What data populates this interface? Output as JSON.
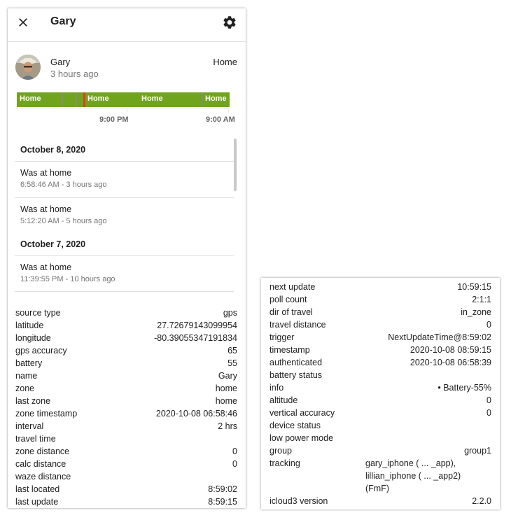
{
  "dialog": {
    "title": "Gary"
  },
  "entity": {
    "name": "Gary",
    "last_changed": "3 hours ago",
    "state": "Home"
  },
  "timeline": {
    "segments": [
      "Home",
      "Home",
      "Home",
      "Home"
    ],
    "ticks": [
      "9:00 PM",
      "9:00 AM"
    ],
    "colors": {
      "home": "#71a41d",
      "marker": "#e53935",
      "gap": "#8a8a7a"
    }
  },
  "logbook": {
    "days": [
      {
        "date": "October 8, 2020",
        "entries": [
          {
            "message": "Was at home",
            "when": "6:58:46 AM - 3 hours ago"
          },
          {
            "message": "Was at home",
            "when": "5:12:20 AM - 5 hours ago"
          }
        ]
      },
      {
        "date": "October 7, 2020",
        "entries": [
          {
            "message": "Was at home",
            "when": "11:39:55 PM - 10 hours ago"
          }
        ]
      }
    ]
  },
  "attributes_left": [
    {
      "key": "source type",
      "value": "gps"
    },
    {
      "key": "latitude",
      "value": "27.72679143099954"
    },
    {
      "key": "longitude",
      "value": "-80.39055347191834"
    },
    {
      "key": "gps accuracy",
      "value": "65"
    },
    {
      "key": "battery",
      "value": "55"
    },
    {
      "key": "name",
      "value": "Gary"
    },
    {
      "key": "zone",
      "value": "home"
    },
    {
      "key": "last zone",
      "value": "home"
    },
    {
      "key": "zone timestamp",
      "value": "2020-10-08 06:58:46"
    },
    {
      "key": "interval",
      "value": "2 hrs"
    },
    {
      "key": "travel time",
      "value": ""
    },
    {
      "key": "zone distance",
      "value": "0"
    },
    {
      "key": "calc distance",
      "value": "0"
    },
    {
      "key": "waze distance",
      "value": ""
    },
    {
      "key": "last located",
      "value": "8:59:02"
    },
    {
      "key": "last update",
      "value": "8:59:15"
    }
  ],
  "attributes_right": [
    {
      "key": "next update",
      "value": "10:59:15"
    },
    {
      "key": "poll count",
      "value": "2:1:1"
    },
    {
      "key": "dir of travel",
      "value": "in_zone"
    },
    {
      "key": "travel distance",
      "value": "0"
    },
    {
      "key": "trigger",
      "value": "NextUpdateTime@8:59:02"
    },
    {
      "key": "timestamp",
      "value": "2020-10-08 08:59:15"
    },
    {
      "key": "authenticated",
      "value": "2020-10-08 06:58:39"
    },
    {
      "key": "battery status",
      "value": ""
    },
    {
      "key": "info",
      "value": "• Battery-55%"
    },
    {
      "key": "altitude",
      "value": "0"
    },
    {
      "key": "vertical accuracy",
      "value": "0"
    },
    {
      "key": "device status",
      "value": ""
    },
    {
      "key": "low power mode",
      "value": ""
    },
    {
      "key": "group",
      "value": "group1"
    },
    {
      "key": "tracking",
      "value": "gary_iphone ( ... _app),\nlillian_iphone ( ... _app2)\n(FmF)"
    },
    {
      "key": "icloud3 version",
      "value": "2.2.0"
    }
  ]
}
